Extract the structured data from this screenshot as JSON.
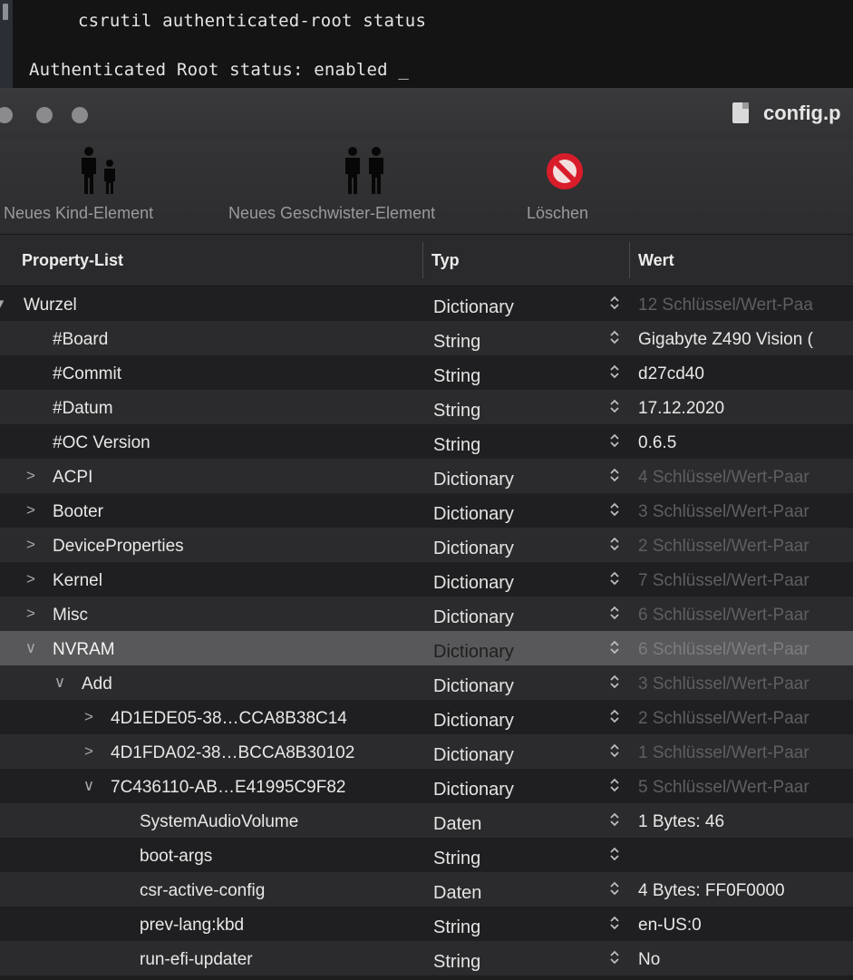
{
  "terminal": {
    "line1": "csrutil authenticated-root status",
    "line2": "Authenticated Root status: enabled",
    "cursor": "_"
  },
  "window": {
    "title": "config.p"
  },
  "toolbar": {
    "new_child": "Neues Kind-Element",
    "new_sibling": "Neues Geschwister-Element",
    "delete": "Löschen"
  },
  "columns": {
    "key": "Property-List",
    "type": "Typ",
    "value": "Wert"
  },
  "rows": [
    {
      "key": "Wurzel",
      "type": "Dictionary",
      "value": "12 Schlüssel/Wert-Paa",
      "disclosure": "▾",
      "level": 0,
      "muted": true
    },
    {
      "key": "#Board",
      "type": "String",
      "value": "Gigabyte Z490 Vision (",
      "disclosure": "",
      "level": 1,
      "muted": false
    },
    {
      "key": "#Commit",
      "type": "String",
      "value": "d27cd40",
      "disclosure": "",
      "level": 1,
      "muted": false
    },
    {
      "key": "#Datum",
      "type": "String",
      "value": "17.12.2020",
      "disclosure": "",
      "level": 1,
      "muted": false
    },
    {
      "key": "#OC Version",
      "type": "String",
      "value": "0.6.5",
      "disclosure": "",
      "level": 1,
      "muted": false
    },
    {
      "key": "ACPI",
      "type": "Dictionary",
      "value": "4 Schlüssel/Wert-Paar",
      "disclosure": ">",
      "level": 1,
      "muted": true
    },
    {
      "key": "Booter",
      "type": "Dictionary",
      "value": "3 Schlüssel/Wert-Paar",
      "disclosure": ">",
      "level": 1,
      "muted": true
    },
    {
      "key": "DeviceProperties",
      "type": "Dictionary",
      "value": "2 Schlüssel/Wert-Paar",
      "disclosure": ">",
      "level": 1,
      "muted": true
    },
    {
      "key": "Kernel",
      "type": "Dictionary",
      "value": "7 Schlüssel/Wert-Paar",
      "disclosure": ">",
      "level": 1,
      "muted": true
    },
    {
      "key": "Misc",
      "type": "Dictionary",
      "value": "6 Schlüssel/Wert-Paar",
      "disclosure": ">",
      "level": 1,
      "muted": true
    },
    {
      "key": "NVRAM",
      "type": "Dictionary",
      "value": "6 Schlüssel/Wert-Paar",
      "disclosure": "∨",
      "level": 1,
      "muted": true,
      "selected": true
    },
    {
      "key": "Add",
      "type": "Dictionary",
      "value": "3 Schlüssel/Wert-Paar",
      "disclosure": "∨",
      "level": 2,
      "muted": true
    },
    {
      "key": "4D1EDE05-38…CCA8B38C14",
      "type": "Dictionary",
      "value": "2 Schlüssel/Wert-Paar",
      "disclosure": ">",
      "level": 3,
      "muted": true
    },
    {
      "key": "4D1FDA02-38…BCCA8B30102",
      "type": "Dictionary",
      "value": "1 Schlüssel/Wert-Paar",
      "disclosure": ">",
      "level": 3,
      "muted": true
    },
    {
      "key": "7C436110-AB…E41995C9F82",
      "type": "Dictionary",
      "value": "5 Schlüssel/Wert-Paar",
      "disclosure": "∨",
      "level": 3,
      "muted": true
    },
    {
      "key": "SystemAudioVolume",
      "type": "Daten",
      "value": "1 Bytes: 46",
      "disclosure": "",
      "level": 4,
      "muted": false
    },
    {
      "key": "boot-args",
      "type": "String",
      "value": "",
      "disclosure": "",
      "level": 4,
      "muted": false
    },
    {
      "key": "csr-active-config",
      "type": "Daten",
      "value": "4 Bytes: FF0F0000",
      "disclosure": "",
      "level": 4,
      "muted": false
    },
    {
      "key": "prev-lang:kbd",
      "type": "String",
      "value": "en-US:0",
      "disclosure": "",
      "level": 4,
      "muted": false
    },
    {
      "key": "run-efi-updater",
      "type": "String",
      "value": "No",
      "disclosure": "",
      "level": 4,
      "muted": false
    }
  ]
}
